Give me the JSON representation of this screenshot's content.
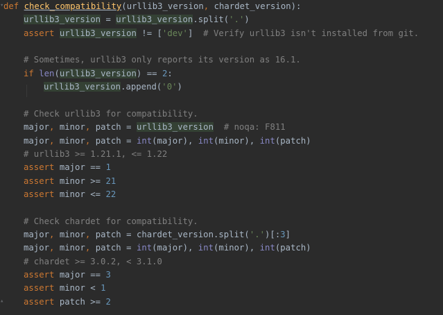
{
  "editor": {
    "lines": [
      {
        "indent": 0,
        "tokens": [
          {
            "t": "def",
            "c": "kw"
          },
          {
            "t": " ",
            "c": "var"
          },
          {
            "t": "check_compatibility",
            "c": "fn",
            "u": true
          },
          {
            "t": "(",
            "c": "var"
          },
          {
            "t": "urllib3_version",
            "c": "var"
          },
          {
            "t": ", ",
            "c": "kw"
          },
          {
            "t": "chardet_version",
            "c": "var"
          },
          {
            "t": "):",
            "c": "var"
          }
        ]
      },
      {
        "indent": 1,
        "tokens": [
          {
            "t": "urllib3_version",
            "c": "var",
            "hl": true
          },
          {
            "t": " = ",
            "c": "var"
          },
          {
            "t": "urllib3_version",
            "c": "var",
            "hl": true
          },
          {
            "t": ".split(",
            "c": "var"
          },
          {
            "t": "'.'",
            "c": "str"
          },
          {
            "t": ")",
            "c": "var"
          }
        ]
      },
      {
        "indent": 1,
        "tokens": [
          {
            "t": "assert",
            "c": "kw"
          },
          {
            "t": " ",
            "c": "var"
          },
          {
            "t": "urllib3_version",
            "c": "var",
            "hl": true
          },
          {
            "t": " != [",
            "c": "var"
          },
          {
            "t": "'dev'",
            "c": "str"
          },
          {
            "t": "]  ",
            "c": "var"
          },
          {
            "t": "# Verify urllib3 isn't installed from git.",
            "c": "cmt"
          }
        ]
      },
      {
        "indent": 1,
        "tokens": []
      },
      {
        "indent": 1,
        "tokens": [
          {
            "t": "# Sometimes, urllib3 only reports its version as 16.1.",
            "c": "cmt"
          }
        ]
      },
      {
        "indent": 1,
        "tokens": [
          {
            "t": "if",
            "c": "kw"
          },
          {
            "t": " ",
            "c": "var"
          },
          {
            "t": "len",
            "c": "bi"
          },
          {
            "t": "(",
            "c": "var"
          },
          {
            "t": "urllib3_version",
            "c": "var",
            "hl": true
          },
          {
            "t": ") == ",
            "c": "var"
          },
          {
            "t": "2",
            "c": "num"
          },
          {
            "t": ":",
            "c": "var"
          }
        ]
      },
      {
        "indent": 2,
        "tokens": [
          {
            "t": "urllib3_version",
            "c": "var",
            "hl": true
          },
          {
            "t": ".append(",
            "c": "var"
          },
          {
            "t": "'0'",
            "c": "str"
          },
          {
            "t": ")",
            "c": "var"
          }
        ]
      },
      {
        "indent": 1,
        "tokens": []
      },
      {
        "indent": 1,
        "tokens": [
          {
            "t": "# Check urllib3 for compatibility.",
            "c": "cmt"
          }
        ]
      },
      {
        "indent": 1,
        "tokens": [
          {
            "t": "major",
            "c": "var"
          },
          {
            "t": ", ",
            "c": "kw"
          },
          {
            "t": "minor",
            "c": "var"
          },
          {
            "t": ", ",
            "c": "kw"
          },
          {
            "t": "patch",
            "c": "var"
          },
          {
            "t": " = ",
            "c": "var"
          },
          {
            "t": "urllib3_version",
            "c": "var",
            "hl": true
          },
          {
            "t": "  ",
            "c": "var"
          },
          {
            "t": "# noqa: F811",
            "c": "cmt"
          }
        ]
      },
      {
        "indent": 1,
        "tokens": [
          {
            "t": "major",
            "c": "var"
          },
          {
            "t": ", ",
            "c": "kw"
          },
          {
            "t": "minor",
            "c": "var"
          },
          {
            "t": ", ",
            "c": "kw"
          },
          {
            "t": "patch",
            "c": "var"
          },
          {
            "t": " = ",
            "c": "var"
          },
          {
            "t": "int",
            "c": "bi"
          },
          {
            "t": "(major), ",
            "c": "var"
          },
          {
            "t": "int",
            "c": "bi"
          },
          {
            "t": "(minor), ",
            "c": "var"
          },
          {
            "t": "int",
            "c": "bi"
          },
          {
            "t": "(patch)",
            "c": "var"
          }
        ]
      },
      {
        "indent": 1,
        "tokens": [
          {
            "t": "# urllib3 >= 1.21.1, <= 1.22",
            "c": "cmt"
          }
        ]
      },
      {
        "indent": 1,
        "tokens": [
          {
            "t": "assert",
            "c": "kw"
          },
          {
            "t": " major == ",
            "c": "var"
          },
          {
            "t": "1",
            "c": "num"
          }
        ]
      },
      {
        "indent": 1,
        "tokens": [
          {
            "t": "assert",
            "c": "kw"
          },
          {
            "t": " minor >= ",
            "c": "var"
          },
          {
            "t": "21",
            "c": "num"
          }
        ]
      },
      {
        "indent": 1,
        "tokens": [
          {
            "t": "assert",
            "c": "kw"
          },
          {
            "t": " minor <= ",
            "c": "var"
          },
          {
            "t": "22",
            "c": "num"
          }
        ]
      },
      {
        "indent": 1,
        "tokens": []
      },
      {
        "indent": 1,
        "tokens": [
          {
            "t": "# Check chardet for compatibility.",
            "c": "cmt"
          }
        ]
      },
      {
        "indent": 1,
        "tokens": [
          {
            "t": "major",
            "c": "var"
          },
          {
            "t": ", ",
            "c": "kw"
          },
          {
            "t": "minor",
            "c": "var"
          },
          {
            "t": ", ",
            "c": "kw"
          },
          {
            "t": "patch",
            "c": "var"
          },
          {
            "t": " = ",
            "c": "var"
          },
          {
            "t": "chardet_version.split(",
            "c": "var"
          },
          {
            "t": "'.'",
            "c": "str"
          },
          {
            "t": ")[:",
            "c": "var"
          },
          {
            "t": "3",
            "c": "num"
          },
          {
            "t": "]",
            "c": "var"
          }
        ]
      },
      {
        "indent": 1,
        "tokens": [
          {
            "t": "major",
            "c": "var"
          },
          {
            "t": ", ",
            "c": "kw"
          },
          {
            "t": "minor",
            "c": "var"
          },
          {
            "t": ", ",
            "c": "kw"
          },
          {
            "t": "patch",
            "c": "var"
          },
          {
            "t": " = ",
            "c": "var"
          },
          {
            "t": "int",
            "c": "bi"
          },
          {
            "t": "(major), ",
            "c": "var"
          },
          {
            "t": "int",
            "c": "bi"
          },
          {
            "t": "(minor), ",
            "c": "var"
          },
          {
            "t": "int",
            "c": "bi"
          },
          {
            "t": "(patch)",
            "c": "var"
          }
        ]
      },
      {
        "indent": 1,
        "tokens": [
          {
            "t": "# chardet >= 3.0.2, < 3.1.0",
            "c": "cmt"
          }
        ]
      },
      {
        "indent": 1,
        "tokens": [
          {
            "t": "assert",
            "c": "kw"
          },
          {
            "t": " major == ",
            "c": "var"
          },
          {
            "t": "3",
            "c": "num"
          }
        ]
      },
      {
        "indent": 1,
        "tokens": [
          {
            "t": "assert",
            "c": "kw"
          },
          {
            "t": " minor < ",
            "c": "var"
          },
          {
            "t": "1",
            "c": "num"
          }
        ]
      },
      {
        "indent": 1,
        "tokens": [
          {
            "t": "assert",
            "c": "kw"
          },
          {
            "t": " patch >= ",
            "c": "var"
          },
          {
            "t": "2",
            "c": "num"
          }
        ]
      }
    ]
  }
}
